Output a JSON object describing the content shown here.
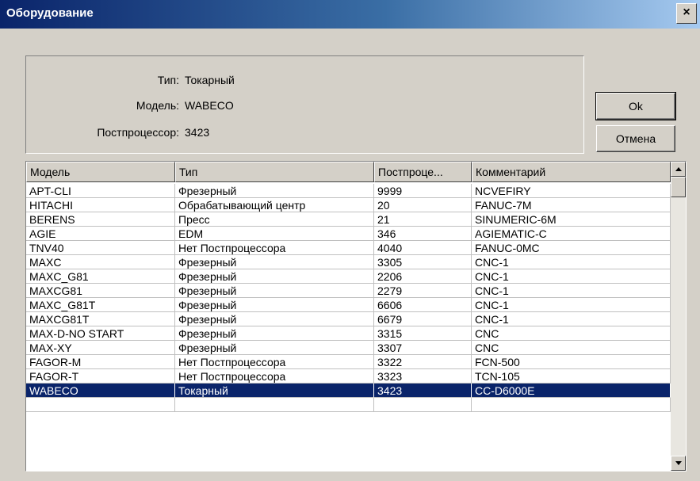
{
  "window": {
    "title": "Оборудование",
    "close_label": "×"
  },
  "info": {
    "type_label": "Тип:",
    "type_value": "Токарный",
    "model_label": "Модель:",
    "model_value": "WABECO",
    "post_label": "Постпроцессор:",
    "post_value": "3423"
  },
  "buttons": {
    "ok": "Ok",
    "cancel": "Отмена"
  },
  "table": {
    "columns": [
      "Модель",
      "Тип",
      "Постпроце...",
      "Комментарий"
    ],
    "rows": [
      [
        "APT-CLI",
        "Фрезерный",
        "9999",
        "NCVEFIRY"
      ],
      [
        "HITACHI",
        "Обрабатывающий центр",
        "20",
        "FANUC-7M"
      ],
      [
        "BERENS",
        "Пресс",
        "21",
        "SINUMERIC-6M"
      ],
      [
        "AGIE",
        "EDM",
        "346",
        "AGIEMATIC-C"
      ],
      [
        "TNV40",
        "Нет Постпроцессора",
        "4040",
        "FANUC-0MC"
      ],
      [
        "MAXC",
        "Фрезерный",
        "3305",
        "CNC-1"
      ],
      [
        "MAXC_G81",
        "Фрезерный",
        "2206",
        "CNC-1"
      ],
      [
        "MAXCG81",
        "Фрезерный",
        "2279",
        "CNC-1"
      ],
      [
        "MAXC_G81T",
        "Фрезерный",
        "6606",
        "CNC-1"
      ],
      [
        "MAXCG81T",
        "Фрезерный",
        "6679",
        "CNC-1"
      ],
      [
        "MAX-D-NO START",
        "Фрезерный",
        "3315",
        "CNC"
      ],
      [
        "MAX-XY",
        "Фрезерный",
        "3307",
        "CNC"
      ],
      [
        "FAGOR-M",
        "Нет Постпроцессора",
        "3322",
        "FCN-500"
      ],
      [
        "FAGOR-T",
        "Нет Постпроцессора",
        "3323",
        "TCN-105"
      ],
      [
        "WABECO",
        "Токарный",
        "3423",
        "CC-D6000E"
      ],
      [
        "",
        "",
        "",
        ""
      ]
    ],
    "selected_index": 14
  }
}
